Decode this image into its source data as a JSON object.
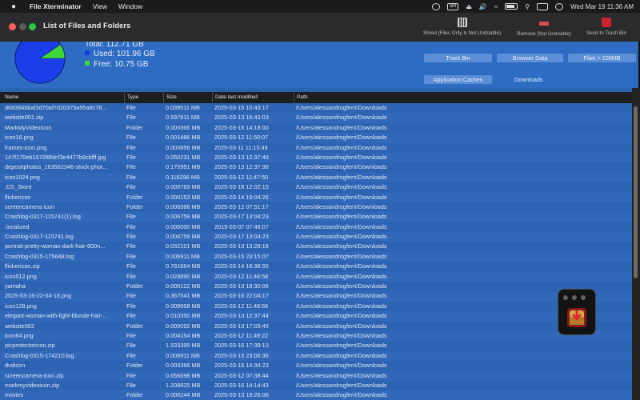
{
  "menubar": {
    "apple": "",
    "app_name": "File Xterminator",
    "menus": [
      "View",
      "Window"
    ],
    "input_badge": "BR",
    "datetime": "Wed Mar 19  11:36 AM"
  },
  "window": {
    "title": "List of Files and Folders",
    "toolbar": {
      "shred_label": "Shred (Files Only & Not Undoable)",
      "remove_label": "Remove (Not Undoable)",
      "trash_label": "Send to Trash Bin"
    }
  },
  "disk": {
    "total": "Total: 112.71 GB",
    "used": "Used: 101.96 GB",
    "free": "Free: 10.75 GB",
    "used_fraction": 0.9046,
    "used_color": "#1a3fe8",
    "free_color": "#3fd93a"
  },
  "filters": {
    "trash_bin": "Trash Bin",
    "browser_data": "Browser Data",
    "files_100mb": "Files > 100MB",
    "app_caches": "Application Caches",
    "downloads": "Downloads"
  },
  "table": {
    "columns": [
      "Name",
      "Type",
      "Size",
      "Date last modified",
      "Path"
    ],
    "rows": [
      [
        "d68364bbaf3d70af7d20375a95a9c78...",
        "File",
        "0.039511 MB",
        "2025-03-15 10:43:17",
        "/Users/alessandrogferri/Downloads"
      ],
      [
        "website001.zip",
        "File",
        "0.597611 MB",
        "2025-03-13 16:43:03",
        "/Users/alessandrogferri/Downloads"
      ],
      [
        "MarkMyVideoIcon",
        "Folder",
        "0.000366 MB",
        "2025-03-16 14:18:00",
        "/Users/alessandrogferri/Downloads"
      ],
      [
        "icon16.png",
        "File",
        "0.001486 MB",
        "2025-03-12 11:50:07",
        "/Users/alessandrogferri/Downloads"
      ],
      [
        "frames-icon.png",
        "File",
        "0.000856 MB",
        "2025-03-11 11:15:49",
        "/Users/alessandrogferri/Downloads"
      ],
      [
        "147f170eb1570f8fdcf3e4477b6cbfff.jpg",
        "File",
        "0.050231 MB",
        "2025-03-13 12:37:49",
        "/Users/alessandrogferri/Downloads"
      ],
      [
        "depositphotos_163562346-stock-phot...",
        "File",
        "0.175951 MB",
        "2025-03-13 12:37:36",
        "/Users/alessandrogferri/Downloads"
      ],
      [
        "icon1024.png",
        "File",
        "0.116296 MB",
        "2025-03-12 11:47:50",
        "/Users/alessandrogferri/Downloads"
      ],
      [
        ".DS_Store",
        "File",
        "0.009769 MB",
        "2025-03-18 12:02:15",
        "/Users/alessandrogferri/Downloads"
      ],
      [
        "flickericon",
        "Folder",
        "0.000153 MB",
        "2025-03-14 19:04:26",
        "/Users/alessandrogferri/Downloads"
      ],
      [
        "screencamera-icon",
        "Folder",
        "0.000366 MB",
        "2025-03-12 07:51:17",
        "/Users/alessandrogferri/Downloads"
      ],
      [
        "Crashlog-0317-115741(1).log",
        "File",
        "0.006759 MB",
        "2025-03-17 13:04:23",
        "/Users/alessandrogferri/Downloads"
      ],
      [
        ".localized",
        "File",
        "0.000000 MB",
        "2019-03-07 07:49:07",
        "/Users/alessandrogferri/Downloads"
      ],
      [
        "Crashlog-0317-115741.log",
        "File",
        "0.006759 MB",
        "2025-03-17 13:04:23",
        "/Users/alessandrogferri/Downloads"
      ],
      [
        "portrait-pretty-woman-dark-hair-600n...",
        "File",
        "0.032101 MB",
        "2025-03-13 13:28:16",
        "/Users/alessandrogferri/Downloads"
      ],
      [
        "Crashlog-0315-175648.log",
        "File",
        "0.006911 MB",
        "2025-03-15 23:15:07",
        "/Users/alessandrogferri/Downloads"
      ],
      [
        "flickericon.zip",
        "File",
        "0.781664 MB",
        "2025-03-14 16:38:55",
        "/Users/alessandrogferri/Downloads"
      ],
      [
        "icon512.png",
        "File",
        "0.028890 MB",
        "2025-03-12 11:48:58",
        "/Users/alessandrogferri/Downloads"
      ],
      [
        "yamaha",
        "Folder",
        "0.000122 MB",
        "2025-03-13 18:30:06",
        "/Users/alessandrogferri/Downloads"
      ],
      [
        "2025-03-16-22-04-16.png",
        "File",
        "0.367541 MB",
        "2025-03-16 22:04:17",
        "/Users/alessandrogferri/Downloads"
      ],
      [
        "icon128.png",
        "File",
        "0.009958 MB",
        "2025-03-12 11:48:56",
        "/Users/alessandrogferri/Downloads"
      ],
      [
        "elegant-woman-with-light-blonde-hair-...",
        "File",
        "0.010350 MB",
        "2025-03-13 12:37:44",
        "/Users/alessandrogferri/Downloads"
      ],
      [
        "website002",
        "Folder",
        "0.000092 MB",
        "2025-03-13 17:03:45",
        "/Users/alessandrogferri/Downloads"
      ],
      [
        "icon64.png",
        "File",
        "0.004154 MB",
        "2025-03-12 11:49:22",
        "/Users/alessandrogferri/Downloads"
      ],
      [
        "picprotectoricon.zip",
        "File",
        "1.533395 MB",
        "2025-03-16 17:39:13",
        "/Users/alessandrogferri/Downloads"
      ],
      [
        "Crashlog-0315-174210.log",
        "File",
        "0.006911 MB",
        "2025-03-15 23:06:36",
        "/Users/alessandrogferri/Downloads"
      ],
      [
        "dvdicon",
        "Folder",
        "0.000366 MB",
        "2025-03-15 14:34:23",
        "/Users/alessandrogferri/Downloads"
      ],
      [
        "screencamera-icon.zip",
        "File",
        "0.656698 MB",
        "2025-03-12 07:38:44",
        "/Users/alessandrogferri/Downloads"
      ],
      [
        "markmyvideoicon.zip",
        "File",
        "1.208825 MB",
        "2025-03-16 14:14:43",
        "/Users/alessandrogferri/Downloads"
      ],
      [
        "movies",
        "Folder",
        "0.000244 MB",
        "2025-03-13 19:26:06",
        "/Users/alessandrogferri/Downloads"
      ]
    ]
  }
}
